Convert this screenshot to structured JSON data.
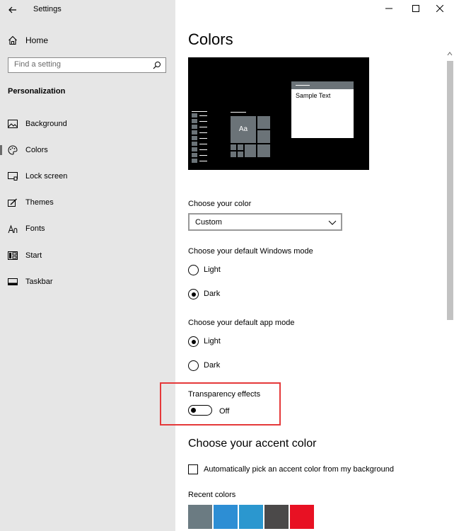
{
  "window": {
    "title": "Settings",
    "controls": {
      "minimize": "minimize-icon",
      "maximize": "maximize-icon",
      "close": "close-icon"
    }
  },
  "sidebar": {
    "home_label": "Home",
    "search_placeholder": "Find a setting",
    "section_title": "Personalization",
    "items": [
      {
        "label": "Background",
        "icon": "picture-icon"
      },
      {
        "label": "Colors",
        "icon": "palette-icon",
        "active": true
      },
      {
        "label": "Lock screen",
        "icon": "lock-screen-icon"
      },
      {
        "label": "Themes",
        "icon": "brush-icon"
      },
      {
        "label": "Fonts",
        "icon": "font-icon"
      },
      {
        "label": "Start",
        "icon": "start-icon"
      },
      {
        "label": "Taskbar",
        "icon": "taskbar-icon"
      }
    ]
  },
  "main": {
    "title": "Colors",
    "preview": {
      "tile_label": "Aa",
      "sample_text": "Sample Text"
    },
    "choose_color": {
      "label": "Choose your color",
      "value": "Custom"
    },
    "windows_mode": {
      "label": "Choose your default Windows mode",
      "options": [
        "Light",
        "Dark"
      ],
      "selected": "Dark"
    },
    "app_mode": {
      "label": "Choose your default app mode",
      "options": [
        "Light",
        "Dark"
      ],
      "selected": "Light"
    },
    "transparency": {
      "label": "Transparency effects",
      "state": "Off"
    },
    "accent": {
      "title": "Choose your accent color",
      "auto_pick_label": "Automatically pick an accent color from my background",
      "auto_pick_checked": false,
      "recent_label": "Recent colors",
      "recent_colors": [
        "#6b7b82",
        "#2d8ed4",
        "#2b97cf",
        "#4b4949",
        "#e81123"
      ]
    }
  },
  "colors": {
    "highlight": "#e5393a",
    "sidebar_bg": "#e6e6e6",
    "preview_tile": "#6b7378"
  }
}
